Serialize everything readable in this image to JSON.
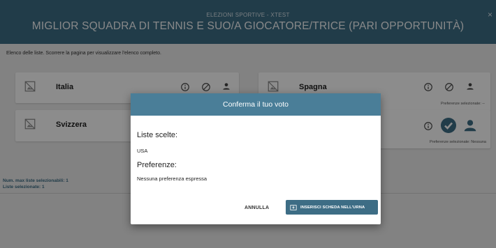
{
  "header": {
    "kicker": "ELEZIONI SPORTIVE - XTEST",
    "title": "MIGLIOR SQUADRA DI TENNIS E SUO/A GIOCATORE/TRICE (PARI OPPORTUNITÀ)",
    "close": "×"
  },
  "hint": "Elenco delle liste. Scorrere la pagina per visualizzare l'elenco completo.",
  "lists": [
    {
      "name": "Italia",
      "preference": ""
    },
    {
      "name": "Spagna",
      "preference": "Preferenze selezionate: --"
    },
    {
      "name": "Svizzera",
      "preference": ""
    },
    {
      "name": "",
      "preference": "Preferenze selezionate: Nessuna"
    }
  ],
  "counts": {
    "max": "Num. max liste selezionabili: 1",
    "selected": "Liste selezionate: 1"
  },
  "modal": {
    "title": "Conferma il tuo voto",
    "lists_label": "Liste scelte:",
    "lists_value": "USA",
    "pref_label": "Preferenze:",
    "pref_value": "Nessuna preferenza espressa",
    "cancel": "ANNULLA",
    "confirm": "INSERISCI SCHEDA NELL'URNA"
  },
  "colors": {
    "header": "#3d6d85",
    "modal_header": "#4a7e98",
    "selected_check": "#3d6d85"
  }
}
